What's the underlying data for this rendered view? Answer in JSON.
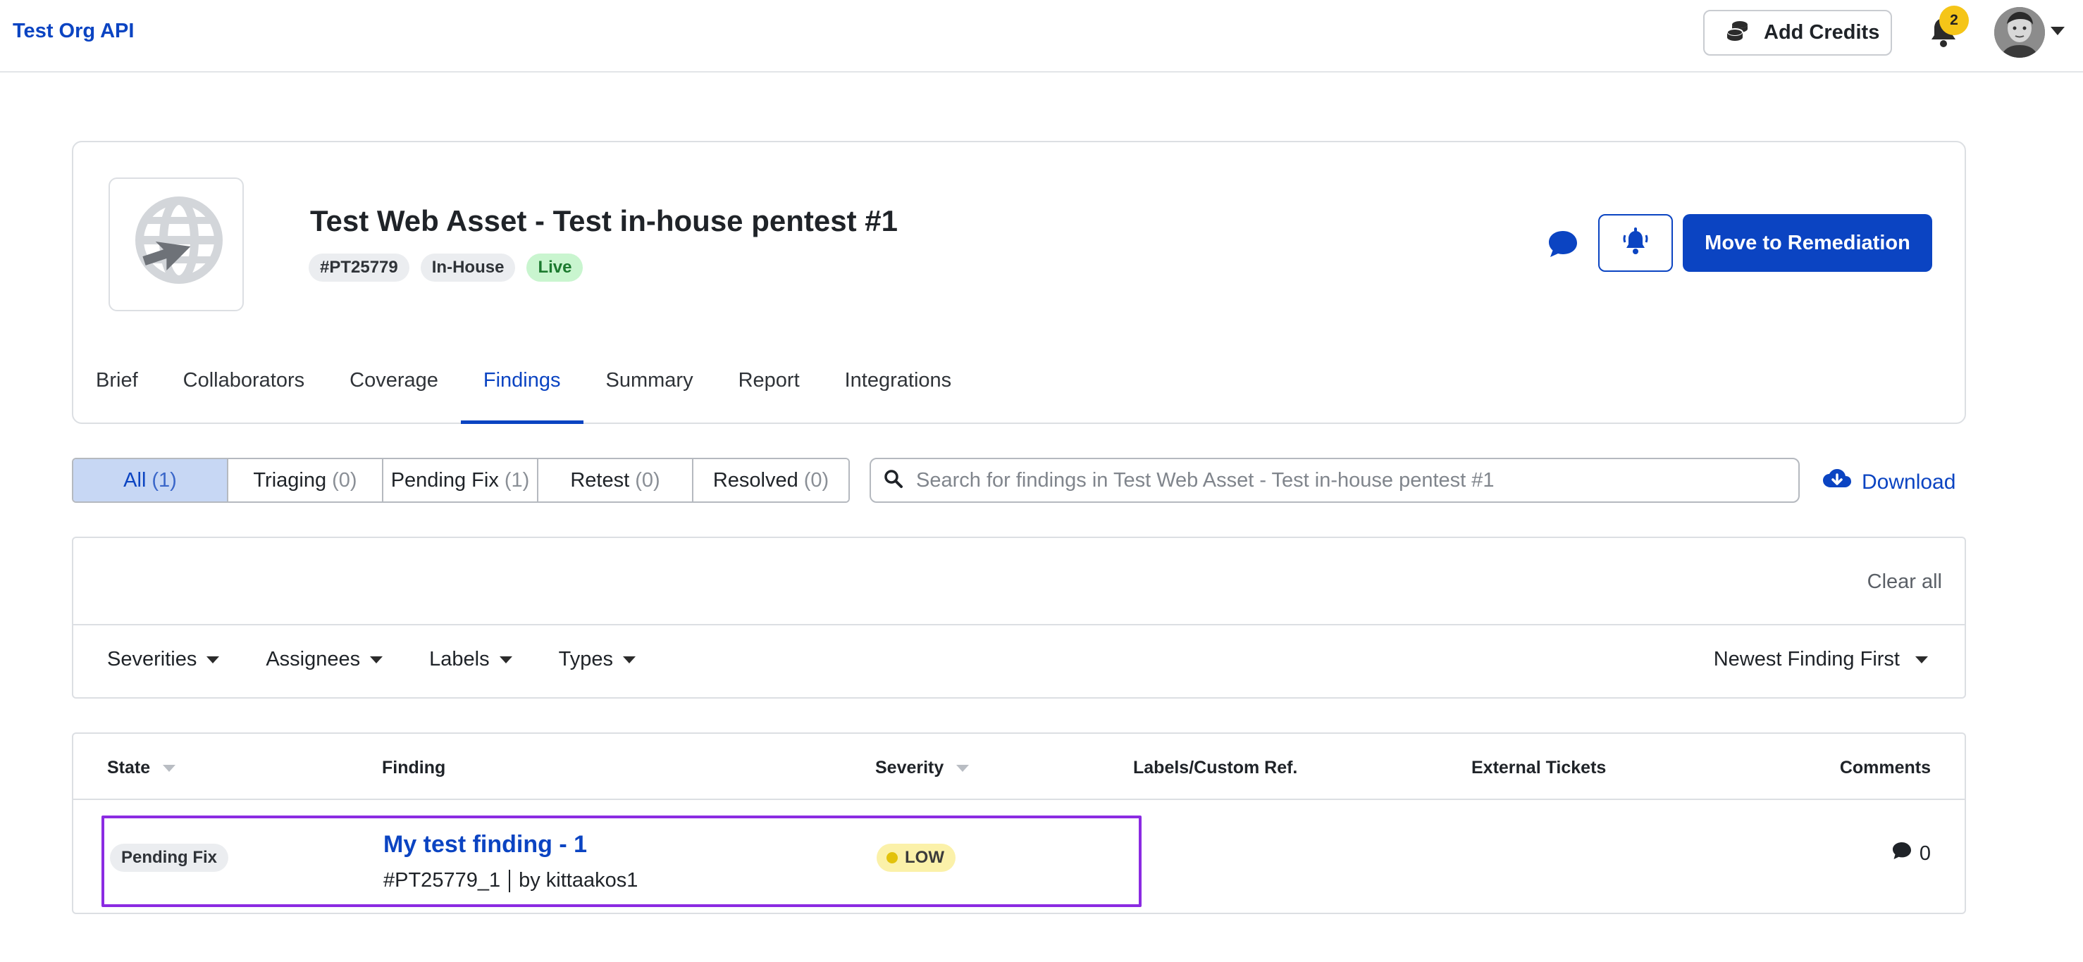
{
  "topbar": {
    "org_name": "Test Org API",
    "add_credits_label": "Add Credits",
    "notifications_count": "2"
  },
  "asset": {
    "title": "Test Web Asset - Test in-house pentest #1",
    "tags": {
      "id": "#PT25779",
      "type": "In-House",
      "status": "Live"
    },
    "primary_action": "Move to Remediation"
  },
  "tabs": [
    {
      "label": "Brief"
    },
    {
      "label": "Collaborators"
    },
    {
      "label": "Coverage"
    },
    {
      "label": "Findings",
      "active": true
    },
    {
      "label": "Summary"
    },
    {
      "label": "Report"
    },
    {
      "label": "Integrations"
    }
  ],
  "status_filters": [
    {
      "label": "All",
      "count": "(1)",
      "active": true
    },
    {
      "label": "Triaging",
      "count": "(0)"
    },
    {
      "label": "Pending Fix",
      "count": "(1)"
    },
    {
      "label": "Retest",
      "count": "(0)"
    },
    {
      "label": "Resolved",
      "count": "(0)"
    }
  ],
  "search": {
    "placeholder": "Search for findings in Test Web Asset - Test in-house pentest #1",
    "value": ""
  },
  "download_label": "Download",
  "filters": {
    "clear_all": "Clear all",
    "dropdowns": [
      "Severities",
      "Assignees",
      "Labels",
      "Types"
    ],
    "sort": "Newest Finding First"
  },
  "table": {
    "columns": {
      "state": "State",
      "finding": "Finding",
      "severity": "Severity",
      "labels": "Labels/Custom Ref.",
      "external": "External Tickets",
      "comments": "Comments"
    },
    "rows": [
      {
        "state": "Pending Fix",
        "title": "My test finding - 1",
        "id": "#PT25779_1",
        "author": "by kittaakos1",
        "severity": "LOW",
        "comments": "0"
      }
    ]
  },
  "colors": {
    "accent": "#0b44c2",
    "live_bg": "#c9f5cf",
    "severity_low_bg": "#fbf1a9",
    "highlight_outline": "#8b2be2",
    "badge": "#f5c518"
  }
}
